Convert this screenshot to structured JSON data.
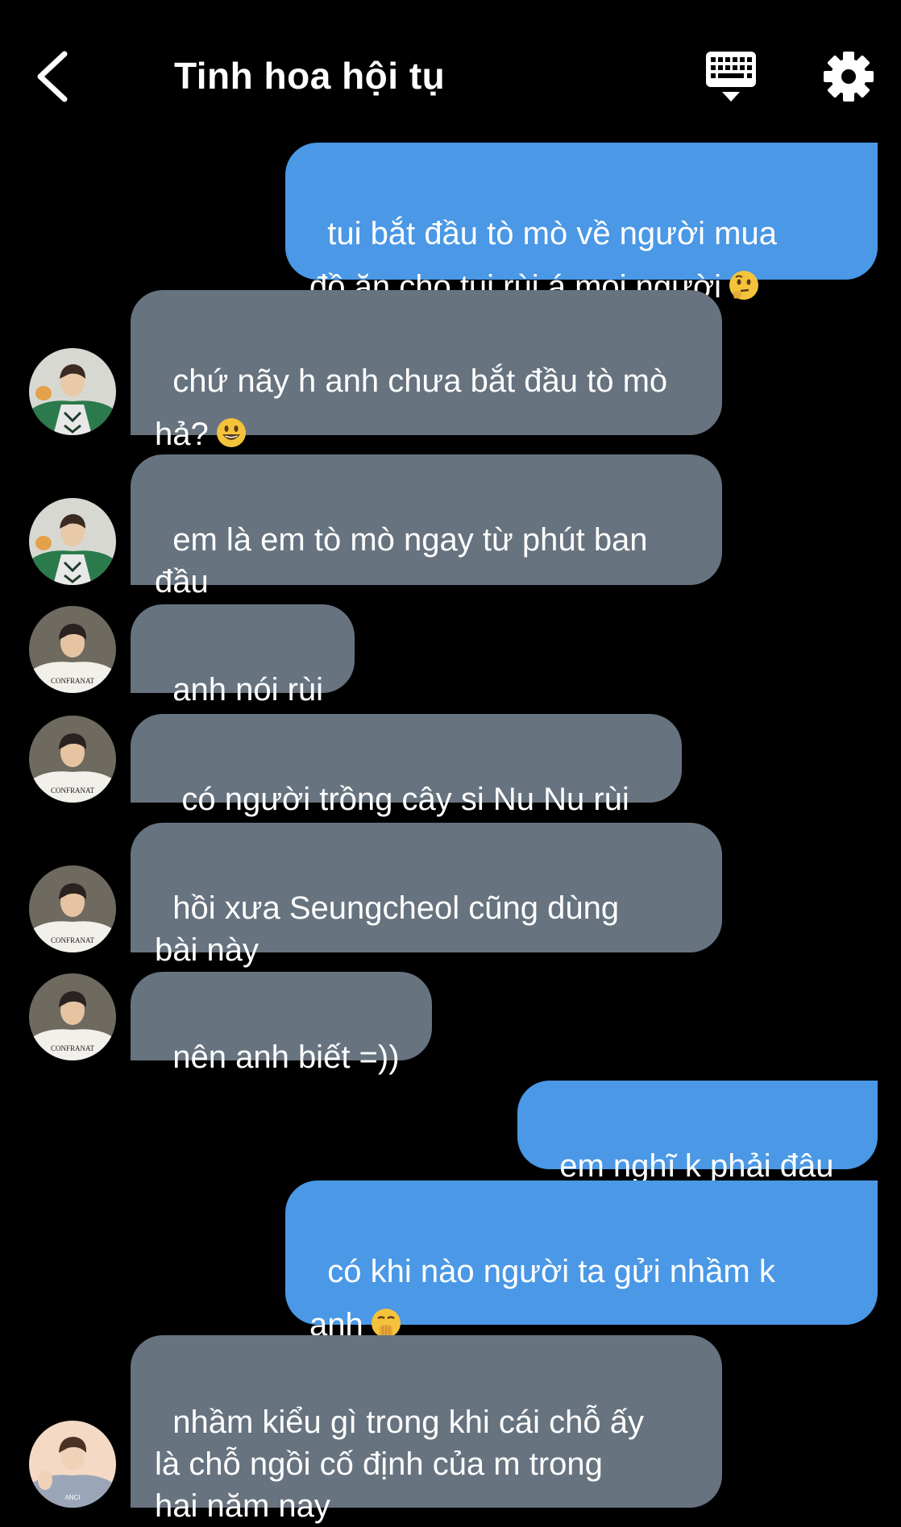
{
  "header": {
    "title": "Tinh hoa hội tụ",
    "back_icon": "chevron-left-icon",
    "keyboard_icon": "keyboard-icon",
    "settings_icon": "gear-icon"
  },
  "colors": {
    "background": "#000000",
    "incoming_bubble": "#67737f",
    "outgoing_bubble": "#4a98e6",
    "text": "#ffffff"
  },
  "messages": [
    {
      "direction": "out",
      "text": "tui bắt đầu tò mò về người mua\nđồ ăn cho tui rùi á mọi người",
      "emoji": "thinking-face-emoji"
    },
    {
      "direction": "in",
      "text": "chứ nãy h anh chưa bắt đầu tò mò\nhả?",
      "emoji": "smiley-face-emoji",
      "avatar": "avatar-green-jacket"
    },
    {
      "direction": "in",
      "text": "em là em tò mò ngay từ phút ban\nđầu",
      "avatar": "avatar-green-jacket"
    },
    {
      "direction": "in",
      "text": "anh nói rùi",
      "avatar": "avatar-white-tee"
    },
    {
      "direction": "in",
      "text": " có người trồng cây si Nu Nu rùi",
      "avatar": "avatar-white-tee"
    },
    {
      "direction": "in",
      "text": "hồi xưa Seungcheol cũng dùng\nbài này",
      "avatar": "avatar-white-tee"
    },
    {
      "direction": "in",
      "text": "nên anh biết =))",
      "avatar": "avatar-white-tee"
    },
    {
      "direction": "out",
      "text": "em nghĩ k phải đâu"
    },
    {
      "direction": "out",
      "text": "có khi nào người ta gửi nhầm k\nanh",
      "emoji": "face-with-hand-over-mouth-emoji"
    },
    {
      "direction": "in",
      "text": "nhầm kiểu gì trong khi cái chỗ ấy\nlà chỗ ngồi cố định của m trong\nhai năm nay",
      "avatar": "avatar-grey-hoodie"
    }
  ]
}
